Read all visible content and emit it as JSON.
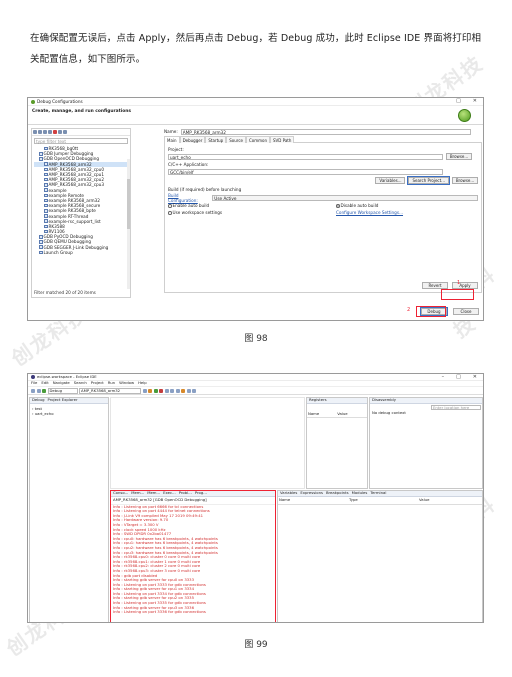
{
  "paragraph": "在确保配置无误后，点击 Apply，然后再点击 Debug，若 Debug 成功，此时 Eclipse IDE 界面将打印相关配置信息，如下图所示。",
  "watermark": "创龙科技",
  "fig98": {
    "caption": "图 98",
    "window_title": "Debug Configurations",
    "header_title": "Create, manage, and run configurations",
    "filter_placeholder": "type filter text",
    "tree": [
      {
        "label": "RK3568_bg0tt",
        "indent": 2,
        "selected": false
      },
      {
        "label": "GDB Jumper Debugging",
        "indent": 1,
        "selected": false
      },
      {
        "label": "GDB OpenOCD Debugging",
        "indent": 1,
        "selected": false
      },
      {
        "label": "AMP_RK3568_arm32",
        "indent": 2,
        "selected": true
      },
      {
        "label": "AMP_RK3568_arm32_cpu0",
        "indent": 2,
        "selected": false
      },
      {
        "label": "AMP_RK3568_arm32_cpu1",
        "indent": 2,
        "selected": false
      },
      {
        "label": "AMP_RK3568_arm32_cpu2",
        "indent": 2,
        "selected": false
      },
      {
        "label": "AMP_RK3568_arm32_cpu3",
        "indent": 2,
        "selected": false
      },
      {
        "label": "example",
        "indent": 2,
        "selected": false
      },
      {
        "label": "example Remote",
        "indent": 2,
        "selected": false
      },
      {
        "label": "example RK3568_arm32",
        "indent": 2,
        "selected": false
      },
      {
        "label": "example RK3568_secure",
        "indent": 2,
        "selected": false
      },
      {
        "label": "example RK3568_bpte",
        "indent": 2,
        "selected": false
      },
      {
        "label": "example RT-Thread",
        "indent": 2,
        "selected": false
      },
      {
        "label": "example-rsc_support_list",
        "indent": 2,
        "selected": false
      },
      {
        "label": "RK3588",
        "indent": 2,
        "selected": false
      },
      {
        "label": "RV1106",
        "indent": 2,
        "selected": false
      },
      {
        "label": "GDB PyOCD Debugging",
        "indent": 1,
        "selected": false
      },
      {
        "label": "GDB QEMU Debugging",
        "indent": 1,
        "selected": false
      },
      {
        "label": "GDB SEGGER J-Link Debugging",
        "indent": 1,
        "selected": false
      },
      {
        "label": "Launch Group",
        "indent": 1,
        "selected": false
      }
    ],
    "filter_footer": "Filter matched 20 of 20 items",
    "name_label": "Name:",
    "name_value": "AMP_RK3568_arm32",
    "tabs": [
      "Main",
      "Debugger",
      "Startup",
      "Source",
      "Common",
      "SVD Path"
    ],
    "project_label": "Project:",
    "project_value": "uart_echo",
    "app_label": "C/C++ Application:",
    "app_value": "GCC/bin/elf",
    "browse": "Browse...",
    "variables": "Variables...",
    "search_project": "Search Project...",
    "build_label": "Build (if required) before launching",
    "build_config_label": "Build Configuration:",
    "build_config_value": "Use Active",
    "enable_auto": "Enable auto build",
    "disable_auto": "Disable auto build",
    "use_workspace": "Use workspace settings",
    "configure_ws": "Configure Workspace Settings...",
    "revert": "Revert",
    "apply": "Apply",
    "debug": "Debug",
    "close": "Close",
    "marker1": "1",
    "marker2": "2"
  },
  "fig99": {
    "caption": "图 99",
    "window_title": "eclipse-workspace - Eclipse IDE",
    "menus": [
      "File",
      "Edit",
      "Navigate",
      "Search",
      "Project",
      "Run",
      "Window",
      "Help"
    ],
    "debug_combo": "Debug",
    "config_combo": "AMP_RK3568_arm32",
    "left_tabs": [
      "Debug",
      "Project Explorer"
    ],
    "projects": [
      "test",
      "uart_echo"
    ],
    "vars_tabs": [
      "Registers"
    ],
    "col_name": "Name",
    "col_value": "Value",
    "col_type": "Type",
    "disasm_tab": "Disassembly",
    "location_placeholder": "Enter location here",
    "no_debug": "No debug context",
    "console_tabs": [
      "Conso...",
      "Mem...",
      "Mem...",
      "Exec...",
      "Probl...",
      "Prog..."
    ],
    "console_header": "AMP_RK3568_arm32 [GDB OpenOCD Debugging]",
    "bottom_tabs": [
      "Variables",
      "Expressions",
      "Breakpoints",
      "Modules",
      "Terminal"
    ],
    "console_lines": [
      "Info : Listening on port 6666 for tcl connections",
      "Info : Listening on port 4444 for telnet connections",
      "Info : J-Link V9 compiled May 17 2019 09:49:41",
      "Info : Hardware version: 9.70",
      "Info : VTarget = 3.300 V",
      "Info : clock speed 1000 kHz",
      "Info : SWD DPIDR 0x2ba01477",
      "Info : cpu0: hardware has 6 breakpoints, 4 watchpoints",
      "Info : cpu1: hardware has 6 breakpoints, 4 watchpoints",
      "Info : cpu2: hardware has 6 breakpoints, 4 watchpoints",
      "Info : cpu3: hardware has 6 breakpoints, 4 watchpoints",
      "Info : rk3568.cpu0: cluster 0 core 0 multi core",
      "Info : rk3568.cpu1: cluster 1 core 0 multi core",
      "Info : rk3568.cpu2: cluster 2 core 0 multi core",
      "Info : rk3568.cpu3: cluster 3 core 0 multi core",
      "Info : gdb port disabled",
      "Info : starting gdb server for cpu0 on 3333",
      "Info : Listening on port 3333 for gdb connections",
      "Info : starting gdb server for cpu1 on 3334",
      "Info : Listening on port 3334 for gdb connections",
      "Info : starting gdb server for cpu2 on 3335",
      "Info : Listening on port 3335 for gdb connections",
      "Info : starting gdb server for cpu3 on 3336",
      "Info : Listening on port 3336 for gdb connections"
    ]
  }
}
